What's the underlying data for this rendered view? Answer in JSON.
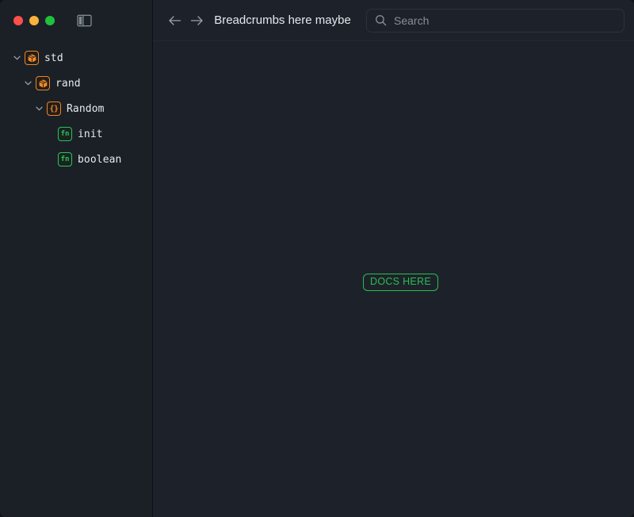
{
  "window": {
    "traffic_lights": [
      {
        "name": "close",
        "color": "#f9504c"
      },
      {
        "name": "minimize",
        "color": "#fab23c"
      },
      {
        "name": "zoom",
        "color": "#1fc23c"
      }
    ],
    "sidebar_toggle_icon": "sidebar-toggle-icon"
  },
  "sidebar": {
    "tree": [
      {
        "label": "std",
        "icon": "package-icon",
        "icon_kind": "pkg",
        "depth": 0,
        "expanded": true,
        "chevron": "chevron-down-icon"
      },
      {
        "label": "rand",
        "icon": "package-icon",
        "icon_kind": "pkg",
        "depth": 1,
        "expanded": true,
        "chevron": "chevron-down-icon"
      },
      {
        "label": "Random",
        "icon": "braces-icon",
        "icon_kind": "brace",
        "icon_text": "{}",
        "depth": 2,
        "expanded": true,
        "chevron": "chevron-down-icon"
      },
      {
        "label": "init",
        "icon": "function-icon",
        "icon_kind": "fn",
        "icon_text": "fn",
        "depth": 3,
        "expanded": null,
        "chevron": null
      },
      {
        "label": "boolean",
        "icon": "function-icon",
        "icon_kind": "fn",
        "icon_text": "fn",
        "depth": 3,
        "expanded": null,
        "chevron": null
      }
    ]
  },
  "toolbar": {
    "back_icon": "arrow-left-icon",
    "forward_icon": "arrow-right-icon",
    "breadcrumb": "Breadcrumbs here maybe",
    "search": {
      "icon": "search-icon",
      "value": "",
      "placeholder": "Search"
    }
  },
  "main": {
    "docs_placeholder": "DOCS HERE"
  },
  "colors": {
    "sidebar_bg": "#1b2026",
    "main_bg": "#1d222a",
    "accent_orange": "#e8862a",
    "accent_green": "#2cc45a",
    "text_primary": "#e6eaee",
    "text_muted": "#868f99",
    "border": "#2b323c"
  }
}
